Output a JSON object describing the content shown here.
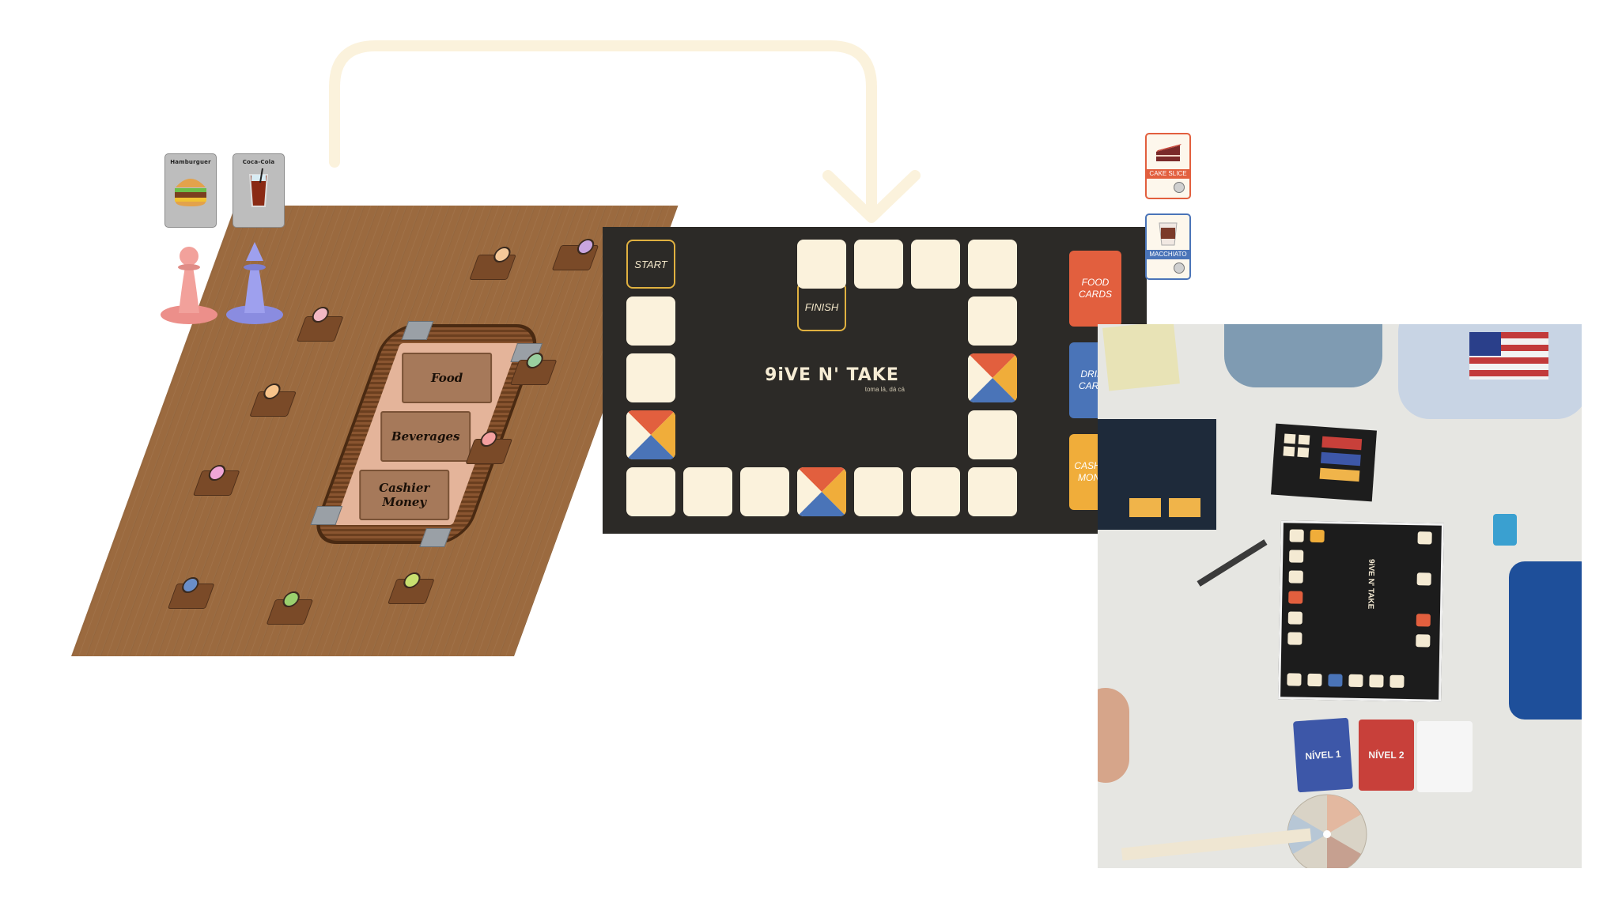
{
  "digital_board": {
    "counter_sections": [
      "Food",
      "Beverages",
      "Cashier\nMoney"
    ],
    "mini_cards": [
      {
        "label": "Hamburguer"
      },
      {
        "label": "Coca-Cola"
      }
    ]
  },
  "physical_board": {
    "start_label": "START",
    "finish_label": "FINISH",
    "brand": "9iVE N' TAKE",
    "tagline": "toma lá, dá cá",
    "decks": [
      {
        "label": "FOOD\nCARDS",
        "color": "#e25f3e"
      },
      {
        "label": "DRINK\nCARDS",
        "color": "#4a74b8"
      },
      {
        "label": "CASHIER\nMONEY",
        "color": "#f0ad3a"
      }
    ],
    "side_cards": [
      {
        "label": "CAKE SLICE",
        "color": "#e25f3e"
      },
      {
        "label": "MACCHIATO",
        "color": "#4a74b8"
      }
    ]
  },
  "photo": {
    "deck_labels": [
      "NÍVEL 1",
      "NÍVEL 2"
    ],
    "board_brand": "9iVE N' TAKE"
  },
  "colors": {
    "arrow": "#fbf2dc",
    "board_bg": "#2c2a27",
    "tile": "#fbf2dc",
    "accent_gold": "#e0b140",
    "red": "#e25f3e",
    "blue": "#4a74b8",
    "yellow": "#f0ad3a"
  }
}
